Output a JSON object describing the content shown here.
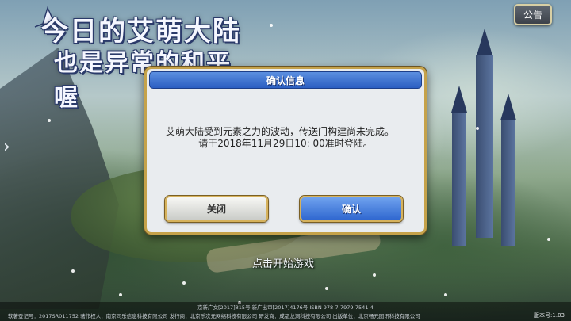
{
  "logo": {
    "line1": "今日的艾萌大陆",
    "line2": "也是异常的和平喔"
  },
  "top_bar": {
    "notice_label": "公告"
  },
  "start_prompt": "点击开始游戏",
  "dialog": {
    "title": "确认信息",
    "message_line1": "艾萌大陆受到元素之力的波动，传送门构建尚未完成。",
    "message_line2": "请于2018年11月29日10: 00准时登陆。",
    "close_label": "关闭",
    "confirm_label": "确认",
    "accent_color": "#2b5ec2",
    "border_color": "#c5a24a"
  },
  "footer": {
    "line1": "京新广文[2017]815号  新广出审[2017]4176号  ISBN 978-7-7979-7541-4",
    "line2": "软著登记号：2017SR011752  著作权人：南京同乐信息科技有限公司  发行商：北京乐次元网络科技有限公司  研发商：成都龙洞科技有限公司  出版单位：北京畅元图讯科技有限公司",
    "version": "版本号:1.03"
  }
}
